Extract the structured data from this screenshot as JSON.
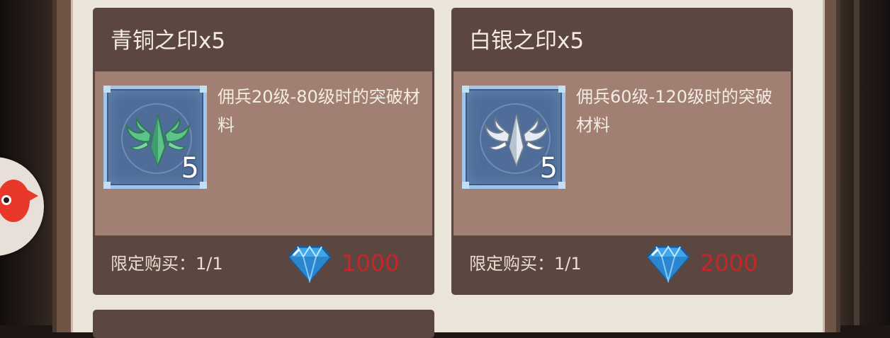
{
  "shop": {
    "items": [
      {
        "title": "青铜之印x5",
        "description": "佣兵20级-80级时的突破材料",
        "quantity": "5",
        "limit": "限定购买：1/1",
        "price": "1000",
        "icon": "bronze-seal-icon",
        "icon_color": "#5ec38a"
      },
      {
        "title": "白银之印x5",
        "description": "佣兵60级-120级时的突破材料",
        "quantity": "5",
        "limit": "限定购买：1/1",
        "price": "2000",
        "icon": "silver-seal-icon",
        "icon_color": "#e6ecf3"
      }
    ],
    "currency_icon": "diamond-icon",
    "price_color": "#c9242a"
  }
}
